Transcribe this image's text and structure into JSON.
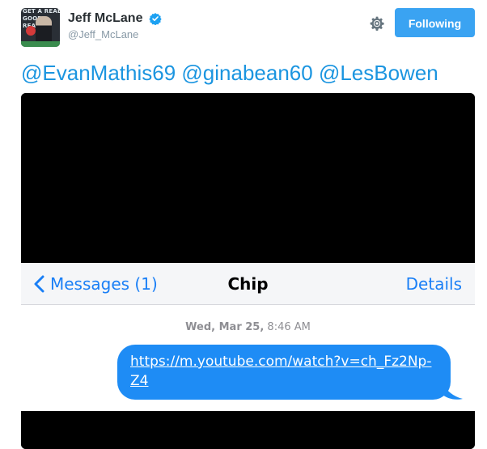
{
  "author": {
    "display_name": "Jeff McLane",
    "handle": "@Jeff_McLane",
    "verified": true,
    "avatar_text": "GET A REAL GOOD READ"
  },
  "actions": {
    "follow_label": "Following",
    "settings_icon": "gear-icon"
  },
  "tweet": {
    "mentions": [
      "@EvanMathis69",
      "@ginabean60",
      "@LesBowen"
    ]
  },
  "screenshot": {
    "nav": {
      "back_label": "Messages (1)",
      "title": "Chip",
      "details_label": "Details"
    },
    "timestamp_day": "Wed, Mar 25,",
    "timestamp_time": "8:46 AM",
    "message_link": "https://m.youtube.com/watch?v=ch_Fz2Np-Z4"
  },
  "colors": {
    "link_blue": "#1b95e0",
    "follow_button": "#3aa3f2",
    "ios_blue": "#1a7ff6",
    "bubble_blue": "#1e8cf5"
  }
}
